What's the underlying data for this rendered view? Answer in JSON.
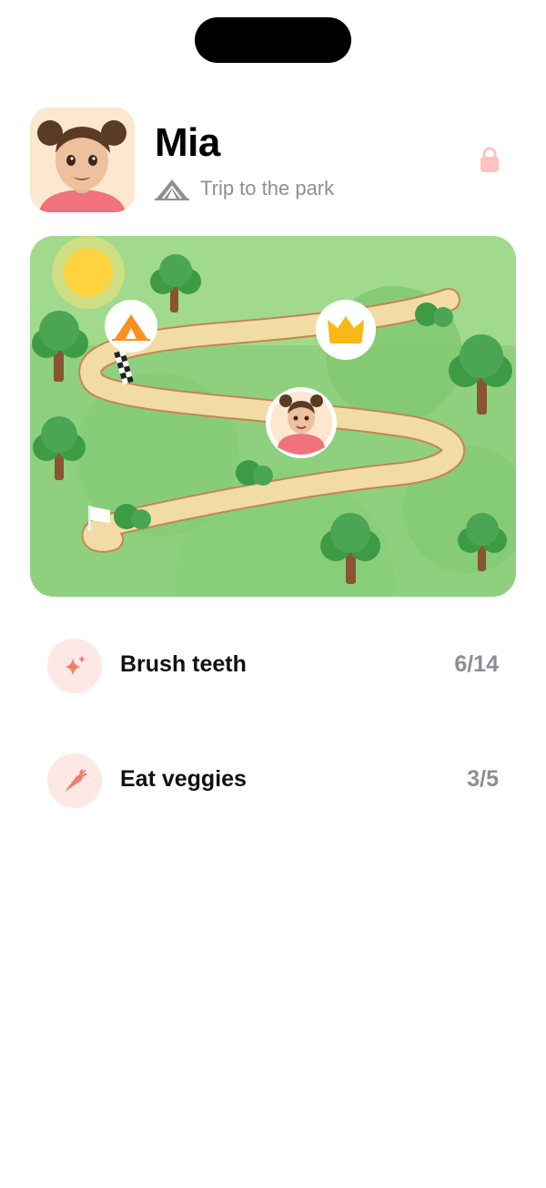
{
  "profile": {
    "name": "Mia",
    "trip_label": "Trip to the park",
    "avatar_icon": "girl-avatar-icon",
    "trip_icon": "tent-icon",
    "lock_icon": "lock-icon"
  },
  "map": {
    "markers": [
      "tent-marker",
      "crown-marker",
      "avatar-marker",
      "start-flag"
    ]
  },
  "tasks": [
    {
      "title": "Brush teeth",
      "count": "6/14",
      "icon": "sparkles-icon"
    },
    {
      "title": "Eat veggies",
      "count": "3/5",
      "icon": "carrot-icon"
    }
  ],
  "colors": {
    "accent": "#f47b6b",
    "accent_soft": "#fde8e6",
    "muted_text": "#8e8e93",
    "map_green": "#8fd07f",
    "path": "#f2dca6"
  }
}
